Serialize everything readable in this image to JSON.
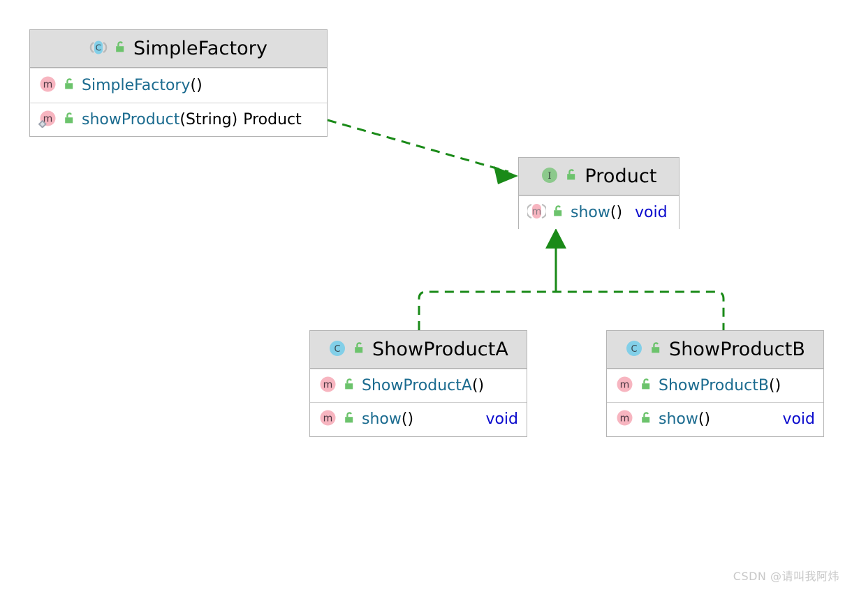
{
  "diagram": {
    "type": "uml-class-diagram",
    "background": "#ffffff",
    "edge_color": "#1a8a18",
    "header_fill": "#dedede",
    "border_color": "#b4b4b4",
    "signature_color": "#1b6b8f",
    "return_type_color": "#0a0acd"
  },
  "classes": {
    "simple_factory": {
      "name": "SimpleFactory",
      "stereotype_icon": "class-icon",
      "stereotype_letter": "C",
      "visibility_icon": "public-unlocked-icon",
      "members": [
        {
          "icon": "method-icon",
          "visibility_icon": "public-unlocked-icon",
          "name": "SimpleFactory",
          "params": "()",
          "return_type": "",
          "abstract": false,
          "overlay_icon": ""
        },
        {
          "icon": "method-icon",
          "visibility_icon": "public-unlocked-icon",
          "name": "showProduct",
          "params": "(String)",
          "return_type": "Product",
          "abstract": false,
          "overlay_icon": "static-diamond-icon"
        }
      ]
    },
    "product": {
      "name": "Product",
      "stereotype_icon": "interface-icon",
      "stereotype_letter": "I",
      "visibility_icon": "public-unlocked-icon",
      "members": [
        {
          "icon": "method-icon",
          "visibility_icon": "public-unlocked-icon",
          "name": "show",
          "params": "()",
          "return_type": "void",
          "abstract": true,
          "overlay_icon": ""
        }
      ]
    },
    "show_product_a": {
      "name": "ShowProductA",
      "stereotype_icon": "class-icon",
      "stereotype_letter": "C",
      "visibility_icon": "public-unlocked-icon",
      "members": [
        {
          "icon": "method-icon",
          "visibility_icon": "public-unlocked-icon",
          "name": "ShowProductA",
          "params": "()",
          "return_type": "",
          "abstract": false,
          "overlay_icon": ""
        },
        {
          "icon": "method-icon",
          "visibility_icon": "public-unlocked-icon",
          "name": "show",
          "params": "()",
          "return_type": "void",
          "abstract": false,
          "overlay_icon": ""
        }
      ]
    },
    "show_product_b": {
      "name": "ShowProductB",
      "stereotype_icon": "class-icon",
      "stereotype_letter": "C",
      "visibility_icon": "public-unlocked-icon",
      "members": [
        {
          "icon": "method-icon",
          "visibility_icon": "public-unlocked-icon",
          "name": "ShowProductB",
          "params": "()",
          "return_type": "",
          "abstract": false,
          "overlay_icon": ""
        },
        {
          "icon": "method-icon",
          "visibility_icon": "public-unlocked-icon",
          "name": "show",
          "params": "()",
          "return_type": "void",
          "abstract": false,
          "overlay_icon": ""
        }
      ]
    }
  },
  "relations": [
    {
      "id": "dependency-simplefactory-product",
      "kind": "dependency",
      "from": "SimpleFactory",
      "to": "Product",
      "line_style": "dashed",
      "arrowhead": "open-filled"
    },
    {
      "id": "realization-showproducta-product",
      "kind": "realization",
      "from": "ShowProductA",
      "to": "Product",
      "line_style": "dashed",
      "arrowhead": "triangle"
    },
    {
      "id": "realization-showproductb-product",
      "kind": "realization",
      "from": "ShowProductB",
      "to": "Product",
      "line_style": "dashed",
      "arrowhead": "triangle"
    }
  ],
  "watermark": {
    "text": "CSDN @请叫我阿炜"
  }
}
